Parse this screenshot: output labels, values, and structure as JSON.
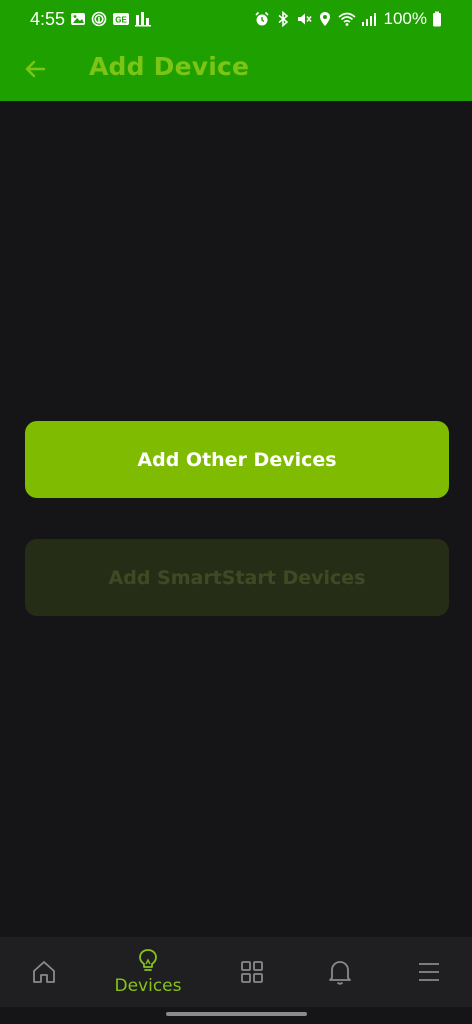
{
  "status_bar": {
    "time": "4:55",
    "battery": "100%",
    "left_icons": [
      "gallery-icon",
      "fingerprint-icon",
      "ge-icon",
      "chart-icon"
    ],
    "right_icons": [
      "alarm-icon",
      "bluetooth-icon",
      "mute-icon",
      "location-icon",
      "wifi-icon",
      "signal-icon",
      "battery-icon"
    ]
  },
  "app_bar": {
    "title": "Add Device",
    "back_icon": "arrow-left-icon"
  },
  "buttons": {
    "add_other": "Add Other Devices",
    "add_smartstart": "Add SmartStart Devices"
  },
  "bottom_nav": {
    "items": [
      {
        "icon": "home-icon",
        "label": ""
      },
      {
        "icon": "lightbulb-icon",
        "label": "Devices",
        "active": true
      },
      {
        "icon": "grid-icon",
        "label": ""
      },
      {
        "icon": "bell-icon",
        "label": ""
      },
      {
        "icon": "menu-icon",
        "label": ""
      }
    ]
  },
  "colors": {
    "header_green": "#1ea000",
    "accent": "#7cc514",
    "primary_button": "#7fbb00",
    "disabled_button": "#262d17",
    "background": "#151517",
    "nav_background": "#1f1f21"
  }
}
